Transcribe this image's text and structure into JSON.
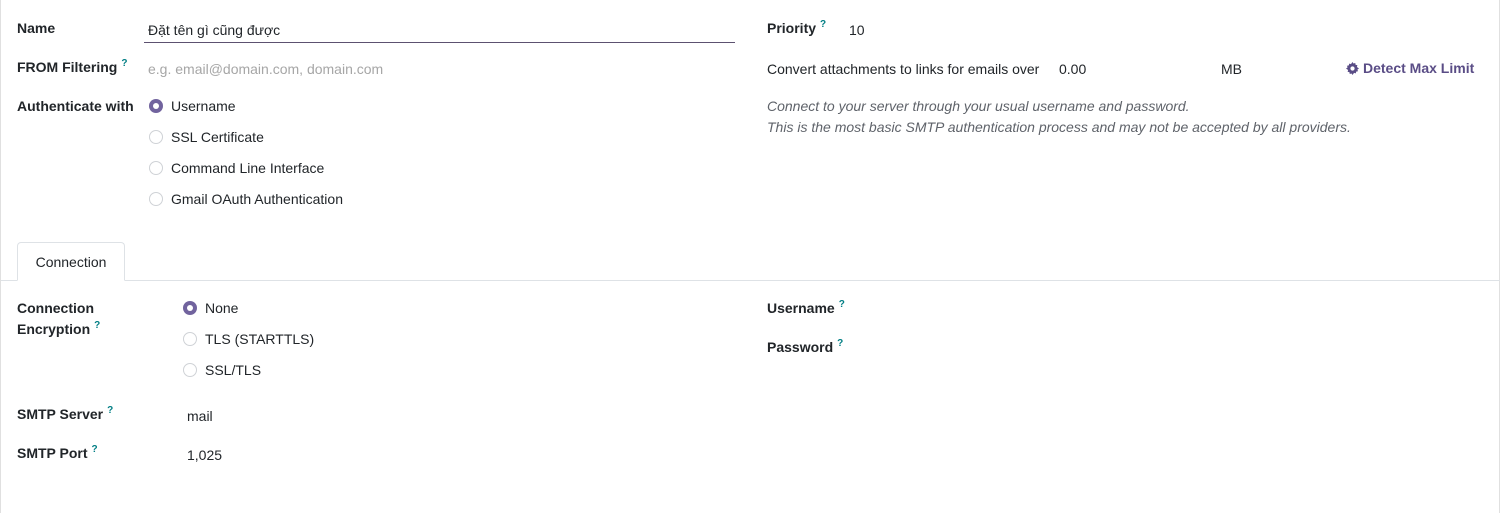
{
  "form": {
    "name_label": "Name",
    "name_value": "Đặt tên gì cũng được",
    "from_filtering_label": "FROM Filtering",
    "from_filtering_placeholder": "e.g. email@domain.com, domain.com",
    "auth_label": "Authenticate with",
    "auth_options": [
      {
        "label": "Username",
        "checked": true
      },
      {
        "label": "SSL Certificate",
        "checked": false
      },
      {
        "label": "Command Line Interface",
        "checked": false
      },
      {
        "label": "Gmail OAuth Authentication",
        "checked": false
      }
    ],
    "priority_label": "Priority",
    "priority_value": "10",
    "attach_label": "Convert attachments to links for emails over",
    "attach_value": "0.00",
    "attach_unit": "MB",
    "detect_button": "Detect Max Limit",
    "auth_help_line1": "Connect to your server through your usual username and password.",
    "auth_help_line2": "This is the most basic SMTP authentication process and may not be accepted by all providers.",
    "help_mark": "?"
  },
  "tabs": [
    {
      "label": "Connection",
      "active": true
    }
  ],
  "connection": {
    "encryption_label_line1": "Connection",
    "encryption_label_line2": "Encryption",
    "encryption_options": [
      {
        "label": "None",
        "checked": true
      },
      {
        "label": "TLS (STARTTLS)",
        "checked": false
      },
      {
        "label": "SSL/TLS",
        "checked": false
      }
    ],
    "smtp_server_label": "SMTP Server",
    "smtp_server_value": "mail",
    "smtp_port_label": "SMTP Port",
    "smtp_port_value": "1,025",
    "username_label": "Username",
    "password_label": "Password"
  },
  "colors": {
    "accent": "#71639e",
    "link": "#5a4d86",
    "help": "#017e84"
  },
  "icons": {
    "detect": "gear-icon"
  }
}
